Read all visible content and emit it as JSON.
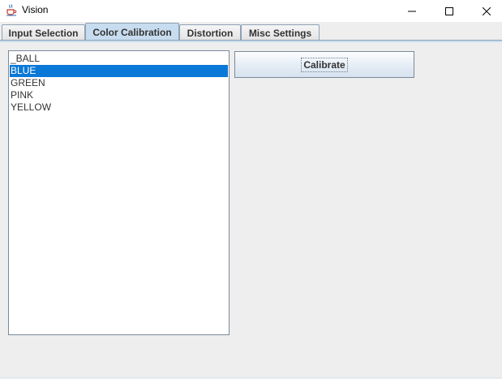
{
  "window": {
    "title": "Vision",
    "controls": [
      "minimize-icon",
      "maximize-icon",
      "close-icon"
    ]
  },
  "tabs": [
    {
      "label": "Input Selection",
      "selected": false
    },
    {
      "label": "Color Calibration",
      "selected": true
    },
    {
      "label": "Distortion",
      "selected": false
    },
    {
      "label": "Misc Settings",
      "selected": false
    }
  ],
  "color_list": {
    "items": [
      "_BALL",
      "BLUE",
      "GREEN",
      "PINK",
      "YELLOW"
    ],
    "selected": "BLUE"
  },
  "calibrate_button": {
    "label": "Calibrate"
  },
  "colors": {
    "selection": "#0a78d7",
    "selected_tab": "#c8dcef",
    "border": "#7a8a99"
  }
}
